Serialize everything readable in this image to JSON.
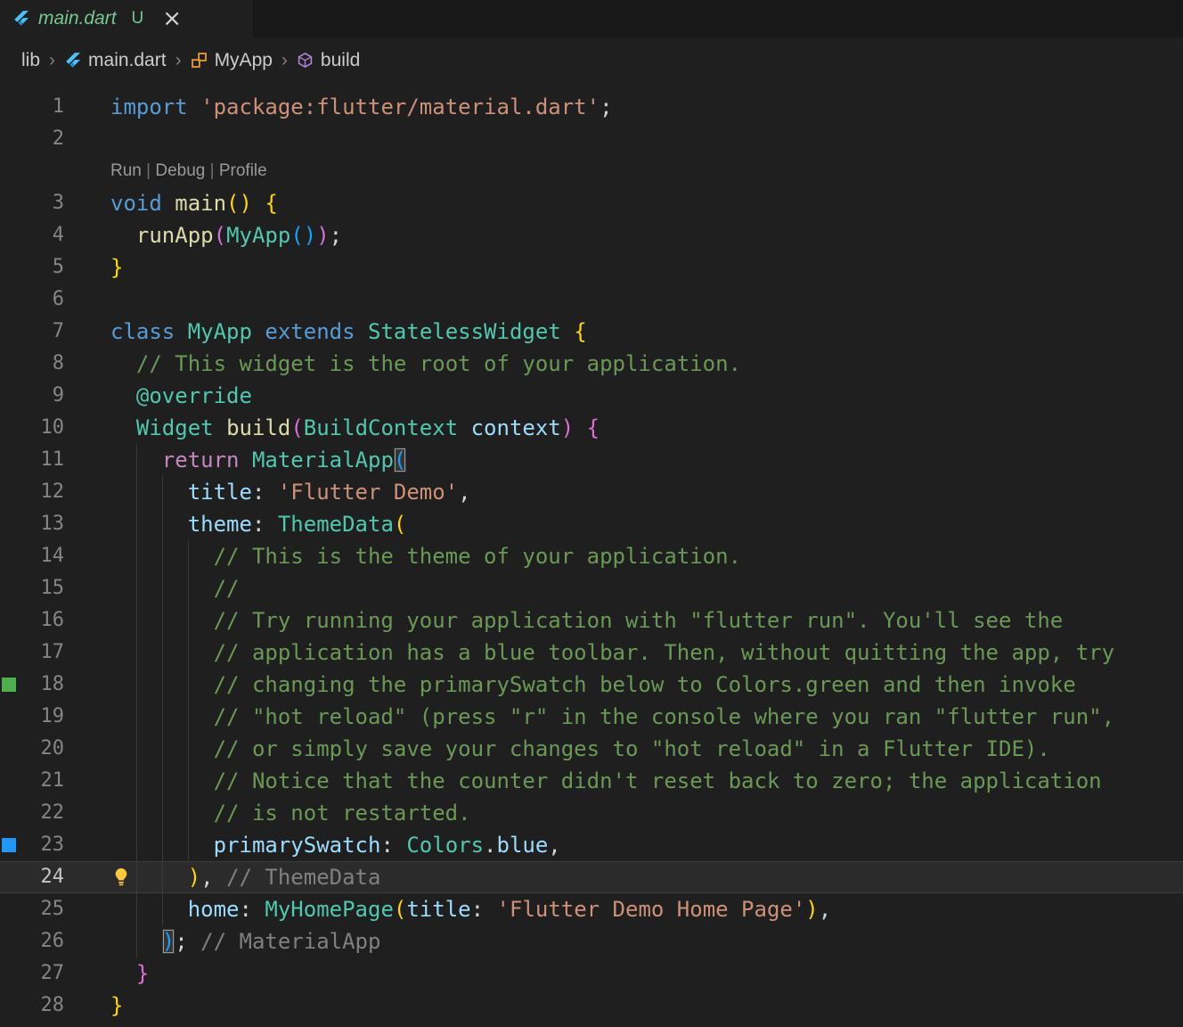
{
  "tab_bar": {
    "tab": {
      "icon": "flutter-icon",
      "title": "main.dart",
      "badge": "U",
      "close_label": "×",
      "title_color": "#73C991"
    }
  },
  "breadcrumb": {
    "separator": "›",
    "items": [
      {
        "label": "lib",
        "icon": null
      },
      {
        "label": "main.dart",
        "icon": "dart-icon"
      },
      {
        "label": "MyApp",
        "icon": "class-icon"
      },
      {
        "label": "build",
        "icon": "method-icon"
      }
    ]
  },
  "codelens": {
    "line": 3,
    "items": [
      "Run",
      "Debug",
      "Profile"
    ],
    "separator": "|"
  },
  "editor": {
    "current_line": 24,
    "lightbulb_line": 24,
    "color_decorators": [
      {
        "line": 18,
        "color": "#4CAF50",
        "name": "green-color-decorator"
      },
      {
        "line": 23,
        "color": "#2196F3",
        "name": "blue-color-decorator"
      }
    ],
    "lines": [
      {
        "n": 1,
        "tokens": [
          [
            "import",
            "kw"
          ],
          [
            " ",
            "pl"
          ],
          [
            "'package:flutter/material.dart'",
            "str"
          ],
          [
            ";",
            "pl"
          ]
        ]
      },
      {
        "n": 2,
        "tokens": []
      },
      {
        "n": 3,
        "tokens": [
          [
            "void",
            "kw"
          ],
          [
            " ",
            "pl"
          ],
          [
            "main",
            "fn"
          ],
          [
            "()",
            "b1"
          ],
          [
            " ",
            "pl"
          ],
          [
            "{",
            "b1"
          ]
        ]
      },
      {
        "n": 4,
        "tokens": [
          [
            "  ",
            "pl"
          ],
          [
            "runApp",
            "fn"
          ],
          [
            "(",
            "b2"
          ],
          [
            "MyApp",
            "type"
          ],
          [
            "()",
            "b3"
          ],
          [
            ")",
            "b2"
          ],
          [
            ";",
            "pl"
          ]
        ]
      },
      {
        "n": 5,
        "tokens": [
          [
            "}",
            "b1"
          ]
        ]
      },
      {
        "n": 6,
        "tokens": []
      },
      {
        "n": 7,
        "tokens": [
          [
            "class",
            "kw"
          ],
          [
            " ",
            "pl"
          ],
          [
            "MyApp",
            "type"
          ],
          [
            " ",
            "pl"
          ],
          [
            "extends",
            "kw"
          ],
          [
            " ",
            "pl"
          ],
          [
            "StatelessWidget",
            "type"
          ],
          [
            " ",
            "pl"
          ],
          [
            "{",
            "b1"
          ]
        ]
      },
      {
        "n": 8,
        "tokens": [
          [
            "  ",
            "pl"
          ],
          [
            "// This widget is the root of your application.",
            "cmt"
          ]
        ]
      },
      {
        "n": 9,
        "tokens": [
          [
            "  ",
            "pl"
          ],
          [
            "@override",
            "type"
          ]
        ]
      },
      {
        "n": 10,
        "tokens": [
          [
            "  ",
            "pl"
          ],
          [
            "Widget",
            "type"
          ],
          [
            " ",
            "pl"
          ],
          [
            "build",
            "fn"
          ],
          [
            "(",
            "b2"
          ],
          [
            "BuildContext",
            "type"
          ],
          [
            " ",
            "pl"
          ],
          [
            "context",
            "prop"
          ],
          [
            ")",
            "b2"
          ],
          [
            " ",
            "pl"
          ],
          [
            "{",
            "b2"
          ]
        ]
      },
      {
        "n": 11,
        "tokens": [
          [
            "    ",
            "pl"
          ],
          [
            "return",
            "ctrl"
          ],
          [
            " ",
            "pl"
          ],
          [
            "MaterialApp",
            "type"
          ],
          [
            "(",
            "b3 match"
          ]
        ]
      },
      {
        "n": 12,
        "tokens": [
          [
            "      ",
            "pl"
          ],
          [
            "title",
            "prop"
          ],
          [
            ": ",
            "pl"
          ],
          [
            "'Flutter Demo'",
            "str"
          ],
          [
            ",",
            "pl"
          ]
        ]
      },
      {
        "n": 13,
        "tokens": [
          [
            "      ",
            "pl"
          ],
          [
            "theme",
            "prop"
          ],
          [
            ": ",
            "pl"
          ],
          [
            "ThemeData",
            "type"
          ],
          [
            "(",
            "b1"
          ]
        ]
      },
      {
        "n": 14,
        "tokens": [
          [
            "        ",
            "pl"
          ],
          [
            "// This is the theme of your application.",
            "cmt"
          ]
        ]
      },
      {
        "n": 15,
        "tokens": [
          [
            "        ",
            "pl"
          ],
          [
            "//",
            "cmt"
          ]
        ]
      },
      {
        "n": 16,
        "tokens": [
          [
            "        ",
            "pl"
          ],
          [
            "// Try running your application with \"flutter run\". You'll see the",
            "cmt"
          ]
        ]
      },
      {
        "n": 17,
        "tokens": [
          [
            "        ",
            "pl"
          ],
          [
            "// application has a blue toolbar. Then, without quitting the app, try",
            "cmt"
          ]
        ]
      },
      {
        "n": 18,
        "tokens": [
          [
            "        ",
            "pl"
          ],
          [
            "// changing the primarySwatch below to Colors.green and then invoke",
            "cmt"
          ]
        ]
      },
      {
        "n": 19,
        "tokens": [
          [
            "        ",
            "pl"
          ],
          [
            "// \"hot reload\" (press \"r\" in the console where you ran \"flutter run\",",
            "cmt"
          ]
        ]
      },
      {
        "n": 20,
        "tokens": [
          [
            "        ",
            "pl"
          ],
          [
            "// or simply save your changes to \"hot reload\" in a Flutter IDE).",
            "cmt"
          ]
        ]
      },
      {
        "n": 21,
        "tokens": [
          [
            "        ",
            "pl"
          ],
          [
            "// Notice that the counter didn't reset back to zero; the application",
            "cmt"
          ]
        ]
      },
      {
        "n": 22,
        "tokens": [
          [
            "        ",
            "pl"
          ],
          [
            "// is not restarted.",
            "cmt"
          ]
        ]
      },
      {
        "n": 23,
        "tokens": [
          [
            "        ",
            "pl"
          ],
          [
            "primarySwatch",
            "prop"
          ],
          [
            ": ",
            "pl"
          ],
          [
            "Colors",
            "type"
          ],
          [
            ".",
            "pl"
          ],
          [
            "blue",
            "prop"
          ],
          [
            ",",
            "pl"
          ]
        ]
      },
      {
        "n": 24,
        "tokens": [
          [
            "      ",
            "pl"
          ],
          [
            ")",
            "b1"
          ],
          [
            ", ",
            "pl"
          ],
          [
            "// ThemeData",
            "lbl"
          ]
        ]
      },
      {
        "n": 25,
        "tokens": [
          [
            "      ",
            "pl"
          ],
          [
            "home",
            "prop"
          ],
          [
            ": ",
            "pl"
          ],
          [
            "MyHomePage",
            "type"
          ],
          [
            "(",
            "b1"
          ],
          [
            "title",
            "prop"
          ],
          [
            ": ",
            "pl"
          ],
          [
            "'Flutter Demo Home Page'",
            "str"
          ],
          [
            ")",
            "b1"
          ],
          [
            ",",
            "pl"
          ]
        ]
      },
      {
        "n": 26,
        "tokens": [
          [
            "    ",
            "pl"
          ],
          [
            ")",
            "b3 match"
          ],
          [
            ";",
            "pl"
          ],
          [
            " ",
            "pl"
          ],
          [
            "// MaterialApp",
            "lbl"
          ]
        ]
      },
      {
        "n": 27,
        "tokens": [
          [
            "  ",
            "pl"
          ],
          [
            "}",
            "b2"
          ]
        ]
      },
      {
        "n": 28,
        "tokens": [
          [
            "}",
            "b1"
          ]
        ]
      }
    ]
  },
  "theme_colors": {
    "editor_background": "#1f1f1f",
    "tab_strip_background": "#181818",
    "keyword": "#569CD6",
    "control": "#C586C0",
    "function": "#DCDCAA",
    "type": "#4EC9B0",
    "property": "#9CDCFE",
    "string": "#CE9178",
    "comment": "#6A9955",
    "closing_label": "#808080",
    "bracket_level1": "#FFD700",
    "bracket_level2": "#DA70D6",
    "bracket_level3": "#179FFF",
    "line_number": "#858585",
    "git_untracked": "#73C991",
    "lightbulb": "#FFC83D"
  }
}
